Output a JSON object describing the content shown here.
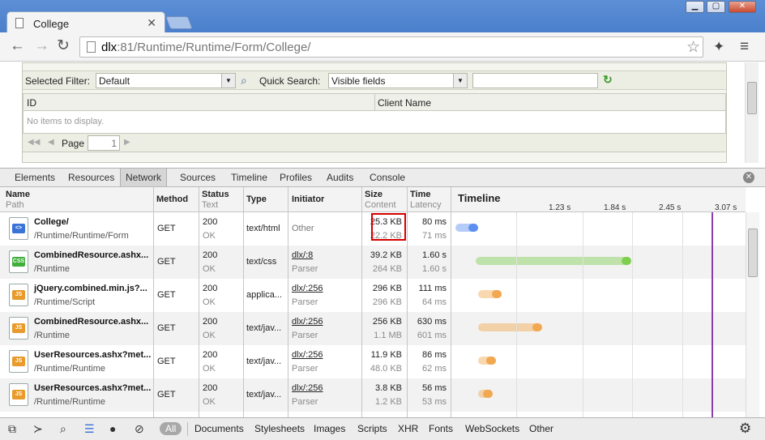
{
  "browser": {
    "tab_title": "College",
    "url_host": "dlx",
    "url_rest": ":81/Runtime/Runtime/Form/College/"
  },
  "page": {
    "filter_label": "Selected Filter:",
    "filter_value": "Default",
    "quick_search_label": "Quick Search:",
    "quick_search_value": "Visible fields",
    "search_value": "",
    "columns": [
      "ID",
      "Client Name"
    ],
    "empty_text": "No items to display.",
    "pager_label": "Page",
    "pager_value": "1"
  },
  "devtools": {
    "tabs": [
      "Elements",
      "Resources",
      "Network",
      "Sources",
      "Timeline",
      "Profiles",
      "Audits",
      "Console"
    ],
    "active_tab": "Network",
    "headers": {
      "name": "Name",
      "path": "Path",
      "method": "Method",
      "status": "Status",
      "text": "Text",
      "type": "Type",
      "initiator": "Initiator",
      "size": "Size",
      "content": "Content",
      "time": "Time",
      "latency": "Latency",
      "timeline": "Timeline"
    },
    "timeline_ticks": [
      "1.23 s",
      "1.84 s",
      "2.45 s",
      "3.07 s"
    ],
    "rows": [
      {
        "name": "College/",
        "path": "/Runtime/Runtime/Form",
        "icon": "HTML",
        "method": "GET",
        "status": "200",
        "status_text": "OK",
        "type": "text/html",
        "initiator": "Other",
        "initiator_sub": "",
        "size": "25.3 KB",
        "content": "22.2 KB",
        "time": "80 ms",
        "latency": "71 ms",
        "bar_start": 0.0,
        "bar_end": 0.08,
        "bar_color": "#5d8ff0"
      },
      {
        "name": "CombinedResource.ashx...",
        "path": "/Runtime",
        "icon": "CSS",
        "method": "GET",
        "status": "200",
        "status_text": "OK",
        "type": "text/css",
        "initiator": "dlx/:8",
        "initiator_sub": "Parser",
        "size": "39.2 KB",
        "content": "264 KB",
        "time": "1.60 s",
        "latency": "1.60 s",
        "bar_start": 0.07,
        "bar_end": 0.61,
        "bar_color": "#7fcf4f"
      },
      {
        "name": "jQuery.combined.min.js?...",
        "path": "/Runtime/Script",
        "icon": "JS",
        "method": "GET",
        "status": "200",
        "status_text": "OK",
        "type": "applica...",
        "initiator": "dlx/:256",
        "initiator_sub": "Parser",
        "size": "296 KB",
        "content": "296 KB",
        "time": "111 ms",
        "latency": "64 ms",
        "bar_start": 0.08,
        "bar_end": 0.16,
        "bar_color": "#f2a850"
      },
      {
        "name": "CombinedResource.ashx...",
        "path": "/Runtime",
        "icon": "JS",
        "method": "GET",
        "status": "200",
        "status_text": "OK",
        "type": "text/jav...",
        "initiator": "dlx/:256",
        "initiator_sub": "Parser",
        "size": "256 KB",
        "content": "1.1 MB",
        "time": "630 ms",
        "latency": "601 ms",
        "bar_start": 0.08,
        "bar_end": 0.3,
        "bar_color": "#f2a850"
      },
      {
        "name": "UserResources.ashx?met...",
        "path": "/Runtime/Runtime",
        "icon": "JS",
        "method": "GET",
        "status": "200",
        "status_text": "OK",
        "type": "text/jav...",
        "initiator": "dlx/:256",
        "initiator_sub": "Parser",
        "size": "11.9 KB",
        "content": "48.0 KB",
        "time": "86 ms",
        "latency": "62 ms",
        "bar_start": 0.08,
        "bar_end": 0.14,
        "bar_color": "#f2a850"
      },
      {
        "name": "UserResources.ashx?met...",
        "path": "/Runtime/Runtime",
        "icon": "JS",
        "method": "GET",
        "status": "200",
        "status_text": "OK",
        "type": "text/jav...",
        "initiator": "dlx/:256",
        "initiator_sub": "Parser",
        "size": "3.8 KB",
        "content": "1.2 KB",
        "time": "56 ms",
        "latency": "53 ms",
        "bar_start": 0.08,
        "bar_end": 0.13,
        "bar_color": "#f2a850"
      }
    ],
    "filters": [
      "All",
      "Documents",
      "Stylesheets",
      "Images",
      "Scripts",
      "XHR",
      "Fonts",
      "WebSockets",
      "Other"
    ],
    "active_filter": "All"
  }
}
